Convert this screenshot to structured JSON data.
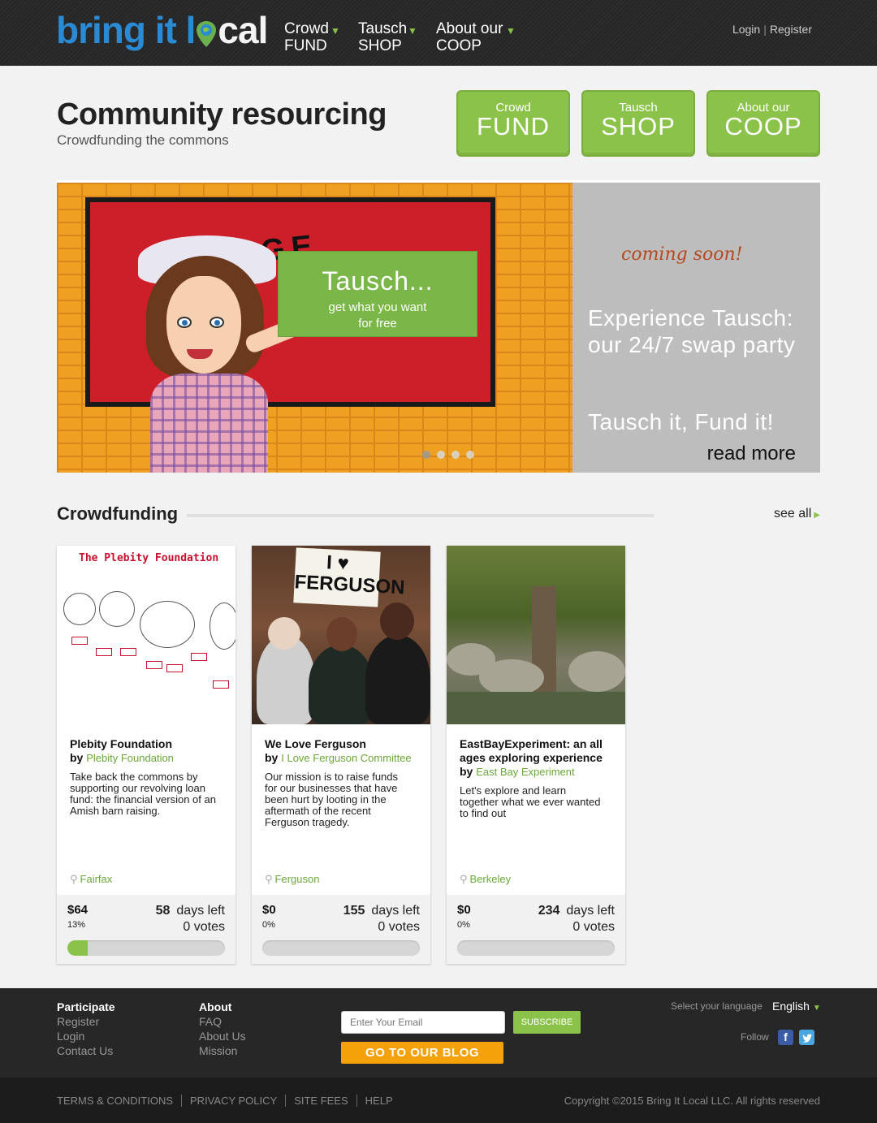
{
  "logo": {
    "part1": "bring it l",
    "part2": "cal"
  },
  "nav": [
    {
      "top": "Crowd",
      "bottom": "FUND"
    },
    {
      "top": "Tausch",
      "bottom": "SHOP"
    },
    {
      "top": "About our",
      "bottom": "COOP"
    }
  ],
  "auth": {
    "login": "Login",
    "separator": "|",
    "register": "Register"
  },
  "hero": {
    "title": "Community resourcing",
    "subtitle": "Crowdfunding the commons",
    "buttons": [
      {
        "small": "Crowd",
        "big": "FUND"
      },
      {
        "small": "Tausch",
        "big": "SHOP"
      },
      {
        "small": "About our",
        "big": "COOP"
      }
    ]
  },
  "slider": {
    "box_title": "Tausch...",
    "box_line1": "get what you want",
    "box_line2": "for free",
    "coming": "coming soon!",
    "exp1": "Experience Tausch:",
    "exp2": "our 24/7 swap party",
    "tagline": "Tausch it, Fund it!",
    "read_more": "read more",
    "slide_count": 4,
    "active_slide": 1
  },
  "section": {
    "title": "Crowdfunding",
    "see_all": "see all"
  },
  "cards": [
    {
      "image_title": "The Plebity Foundation",
      "title": "Plebity Foundation",
      "by": "by",
      "owner": "Plebity Foundation",
      "description": "Take back the commons by supporting our revolving loan fund: the financial version of an Amish barn raising.",
      "location": "Fairfax",
      "amount": "$64",
      "percent": "13%",
      "days": "58",
      "days_label": "days left",
      "votes": "0 votes",
      "progress": 0.13
    },
    {
      "image_title": "I ♥ FERGUSON",
      "title": "We Love Ferguson",
      "by": "by",
      "owner": "I Love Ferguson Committee",
      "description": "Our mission is to raise funds for our businesses that have been hurt by looting in the aftermath of the recent Ferguson tragedy.",
      "location": "Ferguson",
      "amount": "$0",
      "percent": "0%",
      "days": "155",
      "days_label": "days left",
      "votes": "0 votes",
      "progress": 0
    },
    {
      "title": "EastBayExperiment: an all ages exploring experience",
      "by": "by",
      "owner": "East Bay Experiment",
      "description": "Let's explore and learn together what we ever wanted to find out",
      "location": "Berkeley",
      "amount": "$0",
      "percent": "0%",
      "days": "234",
      "days_label": "days left",
      "votes": "0 votes",
      "progress": 0
    }
  ],
  "footer": {
    "participate": {
      "head": "Participate",
      "links": [
        "Register",
        "Login",
        "Contact Us"
      ]
    },
    "about": {
      "head": "About",
      "links": [
        "FAQ",
        "About Us",
        "Mission"
      ]
    },
    "email_placeholder": "Enter Your Email",
    "subscribe": "SUBSCRIBE",
    "blog": "GO TO OUR BLOG",
    "lang_label": "Select your language",
    "lang_value": "English",
    "follow": "Follow",
    "social": [
      "facebook-icon",
      "twitter-icon"
    ]
  },
  "subfooter": {
    "links": [
      "TERMS & CONDITIONS",
      "PRIVACY POLICY",
      "SITE FEES",
      "HELP"
    ],
    "copyright": "Copyright ©2015 Bring It Local LLC. All rights reserved"
  },
  "colors": {
    "accent": "#8bc34a",
    "logo_blue": "#2a8ad4",
    "orange": "#f5a10a",
    "header": "#2a2a2a"
  }
}
